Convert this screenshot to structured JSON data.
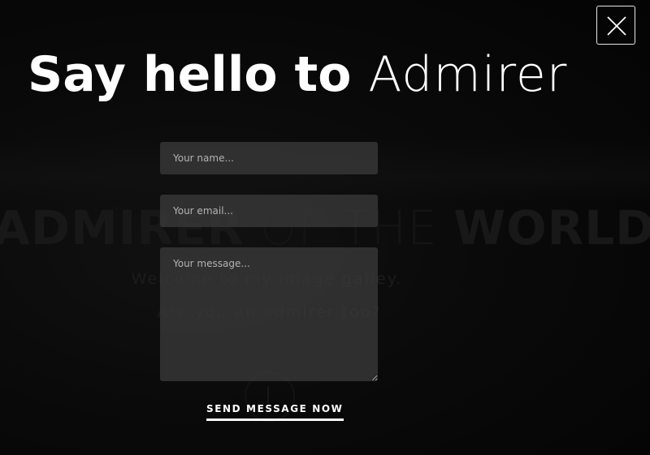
{
  "modal": {
    "title_strong": "Say hello to",
    "title_light": "Admirer",
    "close_icon": "close-icon"
  },
  "form": {
    "name_placeholder": "Your name...",
    "email_placeholder": "Your email...",
    "message_placeholder": "Your message...",
    "submit_label": "SEND MESSAGE NOW"
  },
  "background": {
    "headline_bold_1": "ADMIRER",
    "headline_thin": "OF THE",
    "headline_bold_2": "WORLD.",
    "subtitle_1": "Welcome to my image galley.",
    "subtitle_2": "Are you an admirer too?",
    "scroll_icon": "arrow-down-icon"
  },
  "colors": {
    "background": "#0b0b0b",
    "field_bg": "#3a3a3a",
    "text": "#ffffff"
  }
}
